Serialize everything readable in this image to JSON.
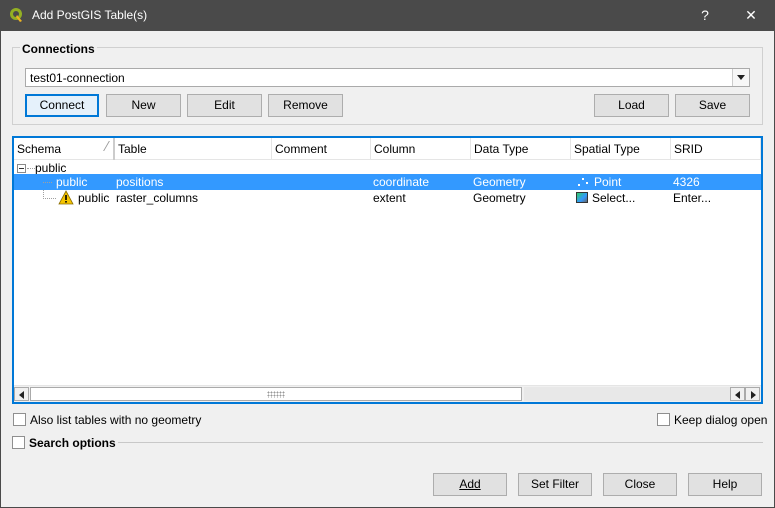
{
  "window": {
    "title": "Add PostGIS Table(s)",
    "help_glyph": "?",
    "close_glyph": "✕",
    "icon": "qgis-logo-icon"
  },
  "connections": {
    "group_title": "Connections",
    "selected_connection": "test01-connection",
    "buttons": {
      "connect": "Connect",
      "new": "New",
      "edit": "Edit",
      "remove": "Remove",
      "load": "Load",
      "save": "Save"
    }
  },
  "table": {
    "columns": [
      "Schema",
      "Table",
      "Comment",
      "Column",
      "Data Type",
      "Spatial Type",
      "SRID"
    ],
    "schema_node": "public",
    "rows": [
      {
        "schema": "public",
        "table": "positions",
        "comment": "",
        "column": "coordinate",
        "data_type": "Geometry",
        "spatial_type": "Point",
        "srid": "4326",
        "selected": true,
        "spatial_icon": "point-icon"
      },
      {
        "schema": "public",
        "table": "raster_columns",
        "comment": "",
        "column": "extent",
        "data_type": "Geometry",
        "spatial_type": "Select...",
        "srid": "Enter...",
        "selected": false,
        "warning": true,
        "spatial_icon": "raster-icon"
      }
    ]
  },
  "options": {
    "also_list_no_geometry": "Also list tables with no geometry",
    "keep_dialog_open": "Keep dialog open",
    "search_options": "Search options"
  },
  "footer": {
    "add": "Add",
    "set_filter": "Set Filter",
    "close": "Close",
    "help": "Help"
  },
  "colors": {
    "titlebar": "#4a4a4a",
    "selection": "#3399ff",
    "focus_border": "#0078d7",
    "warning": "#f5c400"
  }
}
